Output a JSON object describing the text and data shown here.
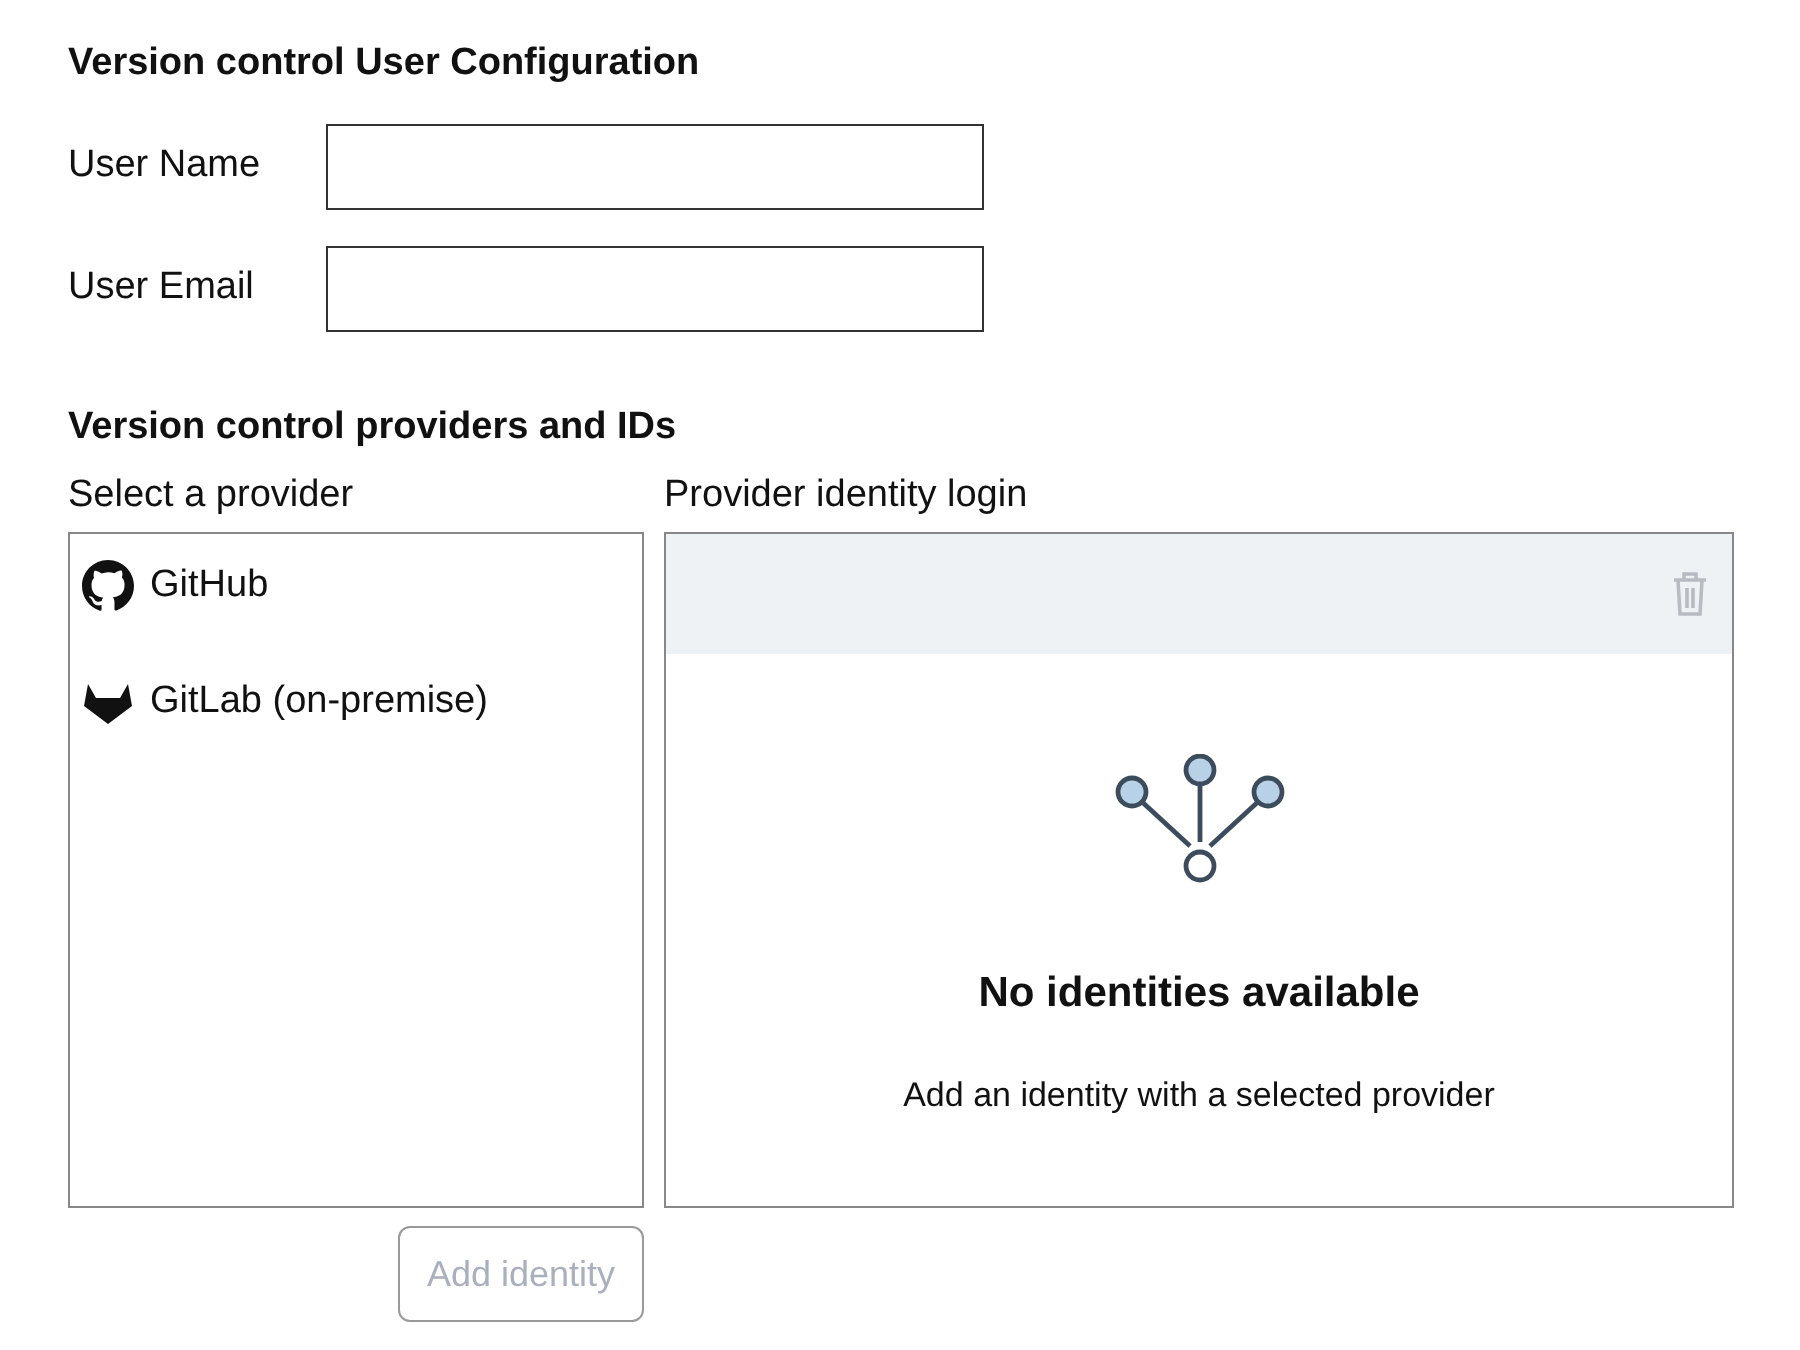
{
  "user_config": {
    "title": "Version control User Configuration",
    "fields": [
      {
        "label": "User Name"
      },
      {
        "label": "User Email"
      }
    ]
  },
  "providers": {
    "title": "Version control providers and IDs",
    "list_label": "Select a provider",
    "items": [
      {
        "kind": "github",
        "label": "GitHub"
      },
      {
        "kind": "gitlab",
        "label": "GitLab (on-premise)"
      }
    ],
    "add_button": {
      "label": "Add identity",
      "disabled": true
    }
  },
  "identity_panel": {
    "label": "Provider identity login",
    "empty_title": "No identities available",
    "empty_text": "Add an identity with a selected provider"
  }
}
